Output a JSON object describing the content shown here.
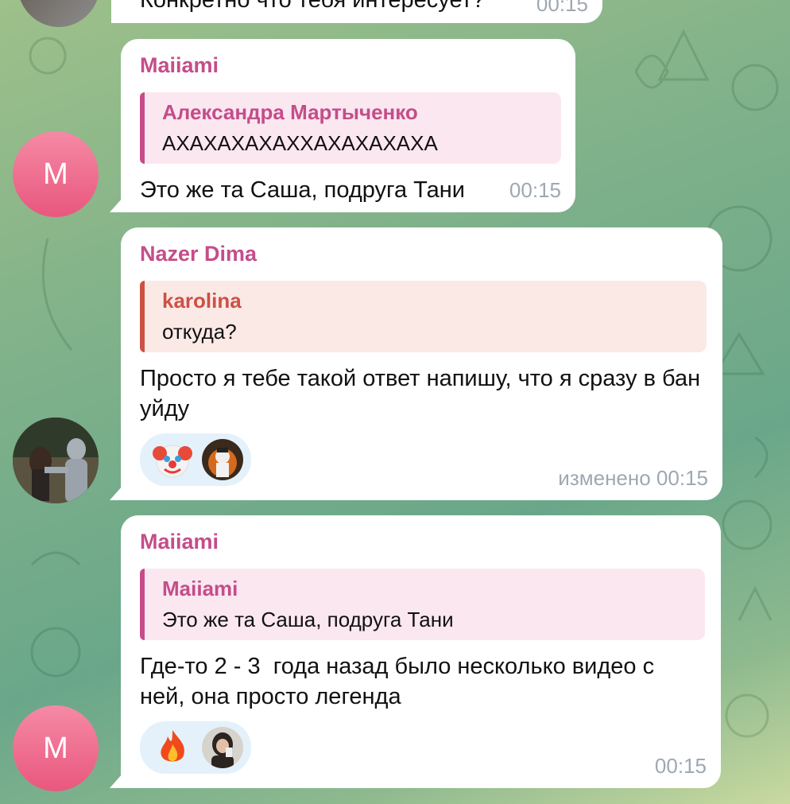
{
  "top_fragment": {
    "text": "Конкретно что тебя интересует?",
    "time": "00:15"
  },
  "messages": [
    {
      "sender": "Maiiami",
      "avatar_letter": "M",
      "reply": {
        "name": "Александра Мартыченко",
        "text": "АХАХАХАХАХХАХАХАХАХА"
      },
      "text": "Это же та Саша, подруга Тани",
      "time": "00:15"
    },
    {
      "sender": "Nazer Dima",
      "reply": {
        "name": "karolina",
        "text": "откуда?"
      },
      "text": "Просто я тебе такой ответ напишу, что я сразу в бан уйду",
      "reactions": [
        {
          "icon": "clown-face-icon"
        },
        {
          "icon": "reactor-avatar"
        }
      ],
      "time": "изменено 00:15"
    },
    {
      "sender": "Maiiami",
      "avatar_letter": "M",
      "reply": {
        "name": "Maiiami",
        "text": "Это же та Саша, подруга Тани"
      },
      "text": "Где-то 2 - 3  года назад было несколько видео с ней, она просто легенда",
      "reactions": [
        {
          "icon": "fire-icon"
        },
        {
          "icon": "reactor-avatar"
        }
      ],
      "time": "00:15"
    }
  ],
  "colors": {
    "accent_pink": "#c44d8a",
    "accent_red": "#cc5145",
    "time_gray": "#9ea8b3"
  }
}
